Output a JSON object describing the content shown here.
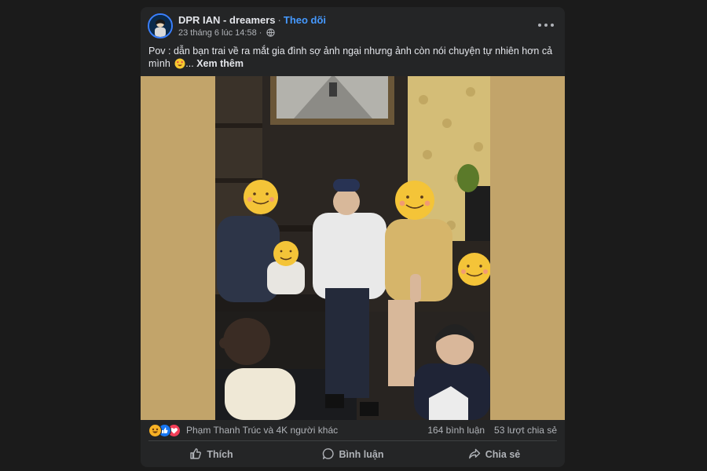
{
  "post": {
    "page_name": "DPR IAN - dreamers",
    "separator": "·",
    "follow_label": "Theo dõi",
    "timestamp": "23 tháng 6 lúc 14:58",
    "privacy_icon": "globe-icon",
    "more_icon": "more-horizontal-icon",
    "caption_text": "Pov : dẫn bạn trai về ra mắt gia đình sợ ảnh ngại nhưng ảnh còn nói chuyện tự nhiên hơn cả mình",
    "caption_emoji": "heart-eyes-face-emoji",
    "ellipsis": "...",
    "see_more": "Xem thêm"
  },
  "reactions": {
    "icons": [
      "haha-icon",
      "like-icon",
      "love-icon"
    ],
    "colors": {
      "haha": "#f7b125",
      "like": "#1877f2",
      "love": "#f33e58"
    },
    "summary": "Phạm Thanh Trúc và 4K người khác",
    "comments": "164 bình luận",
    "shares": "53 lượt chia sẻ"
  },
  "actions": {
    "like": "Thích",
    "comment": "Bình luận",
    "share": "Chia sẻ"
  },
  "colors": {
    "page_bg": "#1b1b1b",
    "card_bg": "#242526",
    "accent_link": "#4599ff",
    "media_bg": "#c2a46a"
  }
}
